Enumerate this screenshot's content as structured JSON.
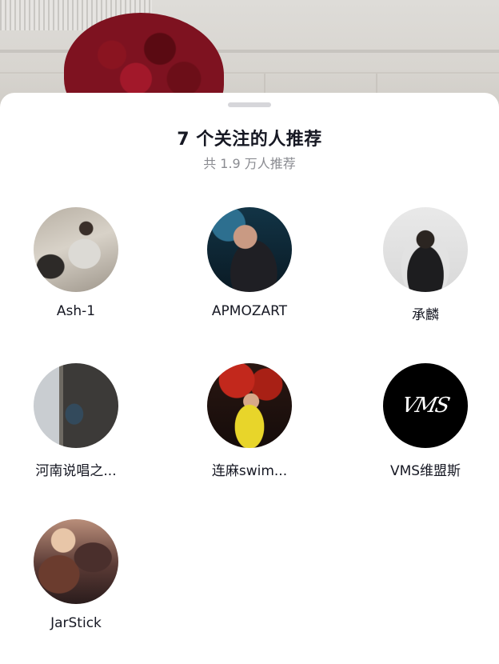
{
  "sheet": {
    "title": "7 个关注的人推荐",
    "subtitle": "共 1.9 万人推荐"
  },
  "users": [
    {
      "name": "Ash-1",
      "avatar_icon": "user-avatar"
    },
    {
      "name": "APMOZART",
      "avatar_icon": "user-avatar"
    },
    {
      "name": "承麟",
      "avatar_icon": "user-avatar"
    },
    {
      "name": "河南说唱之...",
      "avatar_icon": "user-avatar"
    },
    {
      "name": "连麻swim...",
      "avatar_icon": "user-avatar"
    },
    {
      "name": "VMS维盟斯",
      "avatar_icon": "vms-logo",
      "logo_text": "VMS"
    },
    {
      "name": "JarStick",
      "avatar_icon": "user-avatar"
    }
  ],
  "colors": {
    "title": "#161823",
    "subtitle": "#8a8b91",
    "handle": "#d6d6da",
    "sheet_bg": "#ffffff"
  }
}
